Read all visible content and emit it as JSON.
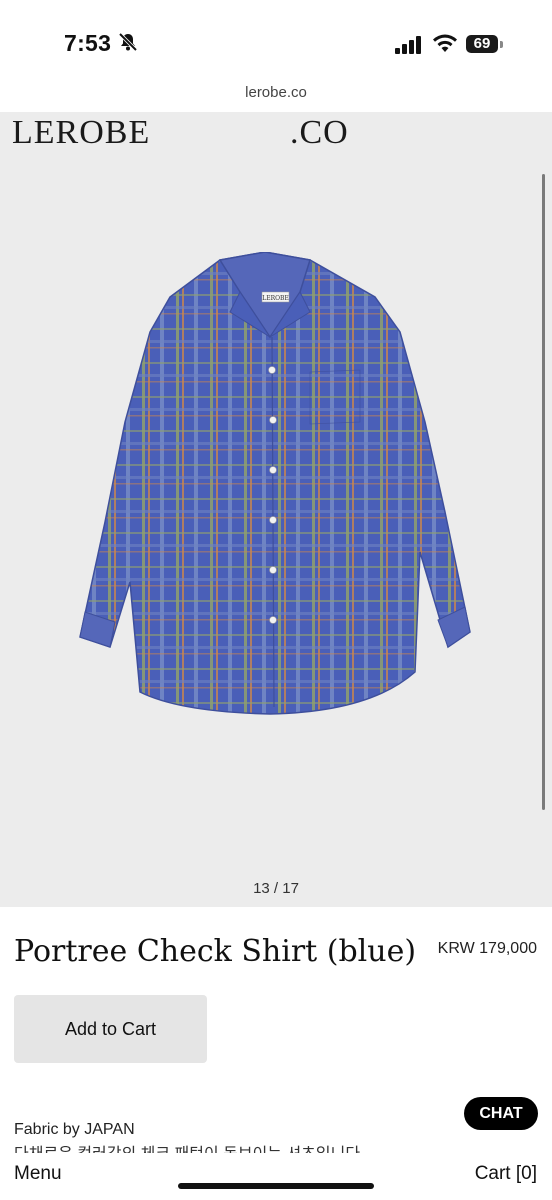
{
  "status": {
    "time": "7:53",
    "battery": "69"
  },
  "browser": {
    "url": "lerobe.co"
  },
  "site": {
    "logo_left": "LEROBE",
    "logo_right": ".CO",
    "label_on_collar": "LEROBE"
  },
  "gallery": {
    "counter": "13 / 17"
  },
  "product": {
    "name": "Portree Check Shirt (blue)",
    "price": "KRW 179,000",
    "add_to_cart": "Add to Cart",
    "fabric": "Fabric by JAPAN",
    "description_fragment": "다채로운 컬러감의 체크 패턴이 돋보이는 셔츠입니다"
  },
  "chat": {
    "label": "CHAT"
  },
  "nav": {
    "menu": "Menu",
    "cart": "Cart [0]"
  },
  "colors": {
    "shirt_base": "#4a5fb8",
    "shirt_check_light": "#8fa06e",
    "shirt_check_orange": "#c9864d",
    "hero_bg": "#ececec",
    "chat_bg": "#000000"
  }
}
